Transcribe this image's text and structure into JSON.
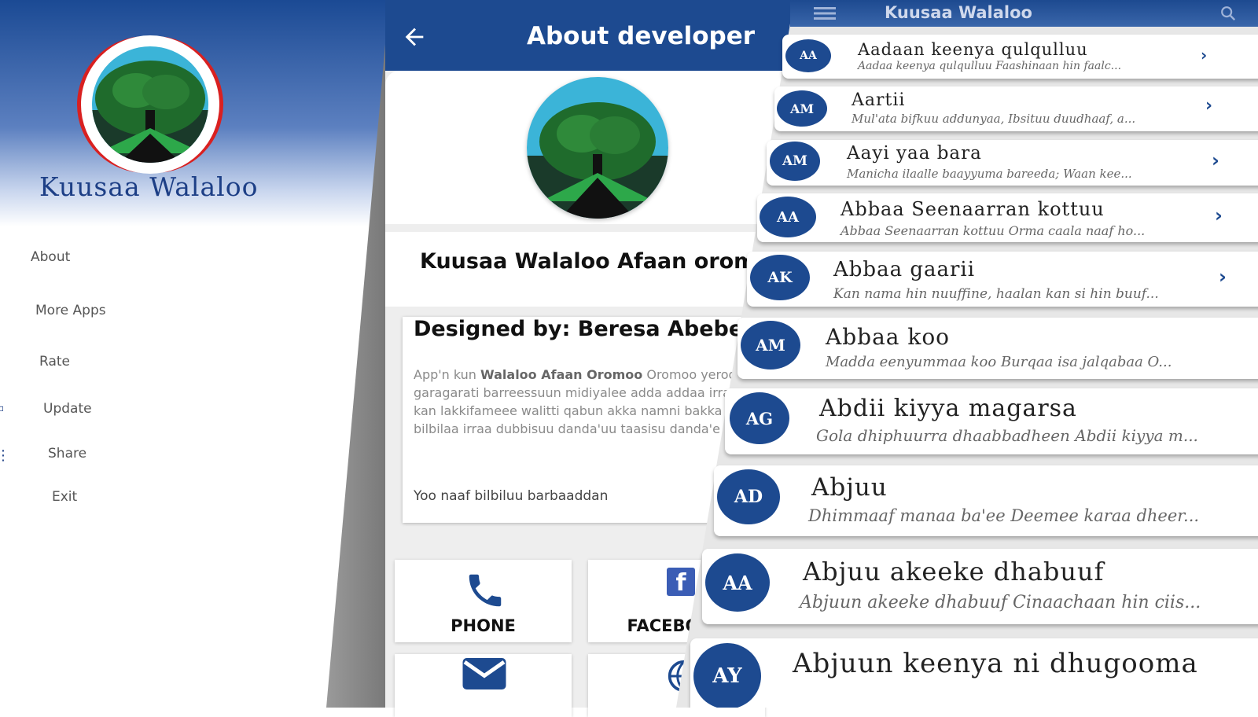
{
  "drawer": {
    "title": "Kuusaa Walaloo",
    "menu": [
      {
        "label": "About",
        "icon": "info-icon"
      },
      {
        "label": "More Apps",
        "icon": "apps-icon"
      },
      {
        "label": "Rate",
        "icon": "star-icon"
      },
      {
        "label": "Update",
        "icon": "update-icon"
      },
      {
        "label": "Share",
        "icon": "share-icon"
      },
      {
        "label": "Exit",
        "icon": "exit-icon"
      }
    ]
  },
  "about": {
    "title": "About developer",
    "app_name": "Kuusaa Walaloo Afaan oromoo",
    "designed_by": "Designed by: Beresa Abebe",
    "description_prefix": "App'n kun ",
    "description_bold": "Walaloo Afaan Oromoo",
    "description_rest": " Oromoo yeroo garagarati barreessuun midiyalee adda addaa irratti gad kan lakkifameee walitti qabun akka namni bakka jiruutti bilbilaa irraa dubbisuu danda'uu taasisu danda'e jira.",
    "note": "Yoo naaf bilbiluu barbaaddan",
    "contacts": {
      "phone": "PHONE",
      "facebook": "FACEBOOK"
    }
  },
  "list": {
    "app_title": "Kuusaa Walaloo",
    "items": [
      {
        "badge": "AA",
        "title": "Aadaan keenya qulqulluu",
        "subtitle": "Aadaa keenya qulqulluu Faashinaan hin faalc..."
      },
      {
        "badge": "AM",
        "title": "Aartii",
        "subtitle": "Mul'ata bifkuu addunyaa, Ibsituu duudhaaf, a..."
      },
      {
        "badge": "AM",
        "title": "Aayi yaa bara",
        "subtitle": "Manicha ilaalle baayyuma bareeda; Waan kee..."
      },
      {
        "badge": "AA",
        "title": "Abbaa Seenaarran kottuu",
        "subtitle": "Abbaa Seenaarran kottuu Orma caala naaf ho..."
      },
      {
        "badge": "AK",
        "title": "Abbaa gaarii",
        "subtitle": "Kan nama hin nuuffine, haalan kan si hin buuf..."
      },
      {
        "badge": "AM",
        "title": "Abbaa koo",
        "subtitle": "Madda eenyummaa koo Burqaa isa jalqabaa O..."
      },
      {
        "badge": "AG",
        "title": "Abdii kiyya magarsa",
        "subtitle": "Gola dhiphuurra dhaabbadheen Abdii kiyya m..."
      },
      {
        "badge": "AD",
        "title": "Abjuu",
        "subtitle": "Dhimmaaf manaa ba'ee Deemee karaa dheer..."
      },
      {
        "badge": "AA",
        "title": "Abjuu akeeke dhabuuf",
        "subtitle": "Abjuun akeeke dhabuuf Cinaachaan hin ciis..."
      },
      {
        "badge": "AY",
        "title": "Abjuun keenya ni dhugooma",
        "subtitle": ""
      }
    ]
  },
  "colors": {
    "primary": "#1d4a90",
    "accent_red": "#d92020"
  }
}
